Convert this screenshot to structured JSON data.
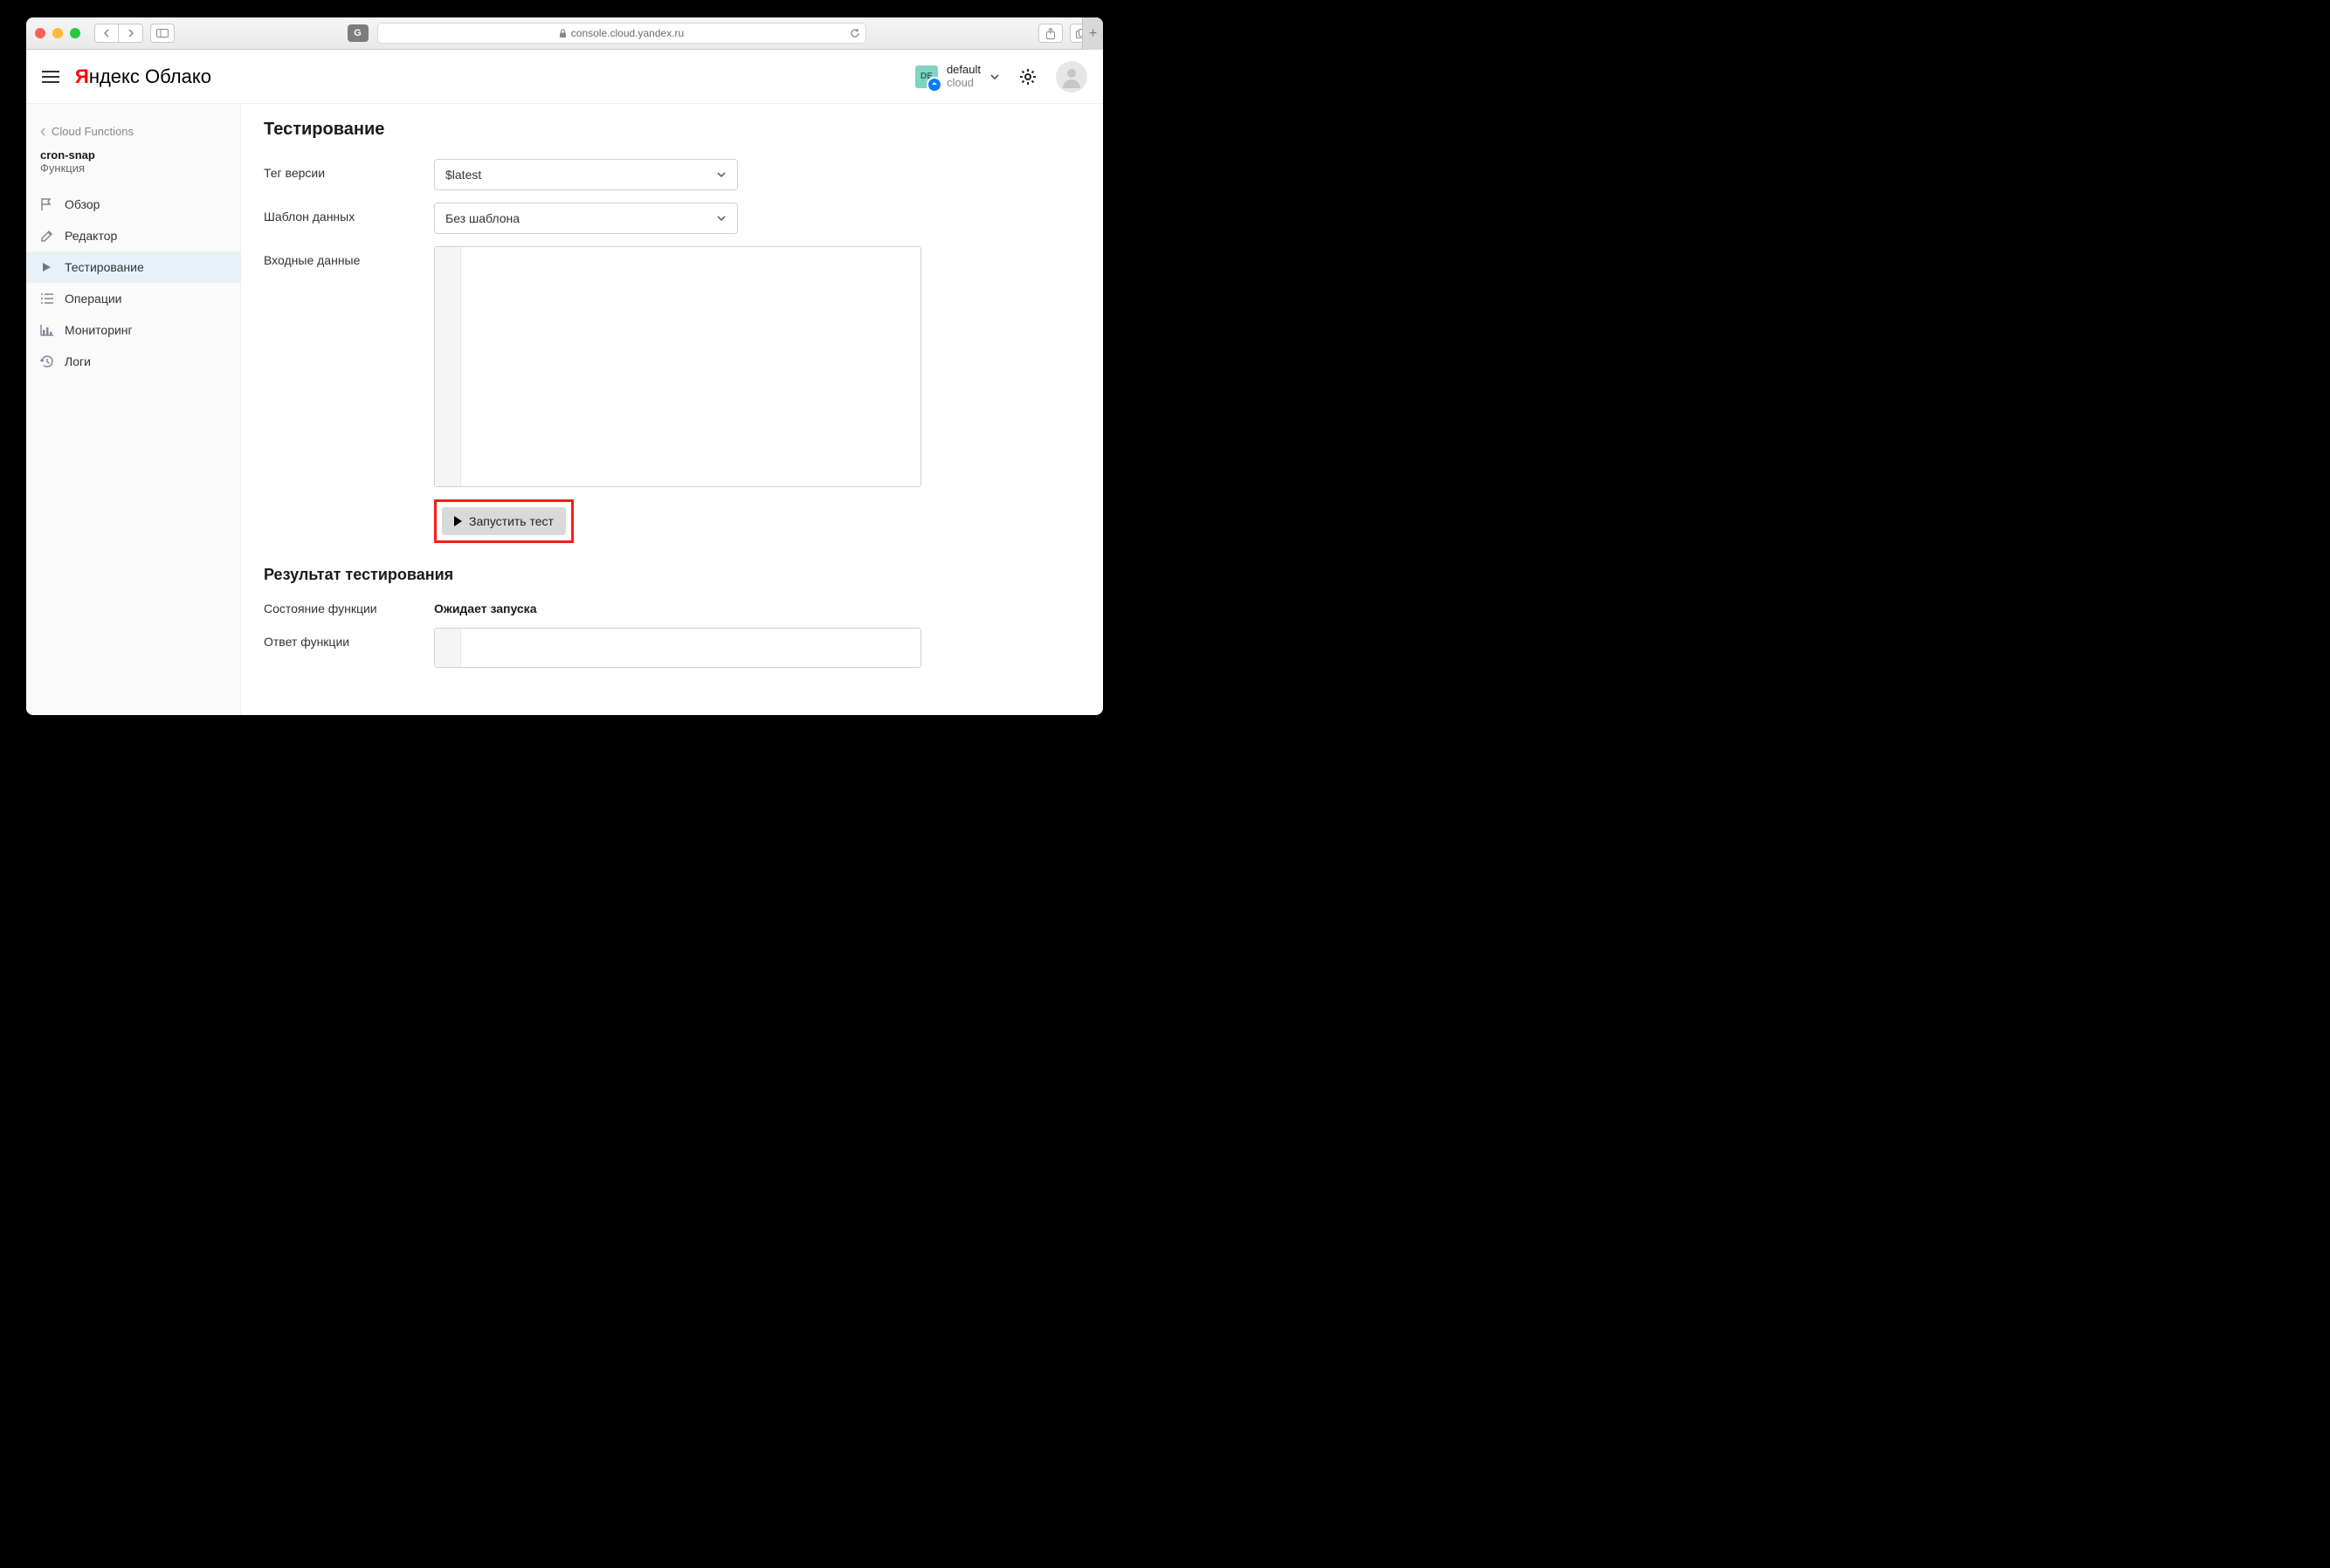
{
  "browser": {
    "url": "console.cloud.yandex.ru",
    "reader_badge": "G"
  },
  "header": {
    "logo_prefix": "Я",
    "logo_ndex": "ндекс",
    "logo_cloud": " Облако",
    "cloud_badge": "DE",
    "cloud_name": "default",
    "cloud_sub": "cloud"
  },
  "sidebar": {
    "breadcrumb": "Cloud Functions",
    "function_name": "cron-snap",
    "function_sub": "Функция",
    "items": [
      {
        "label": "Обзор"
      },
      {
        "label": "Редактор"
      },
      {
        "label": "Тестирование"
      },
      {
        "label": "Операции"
      },
      {
        "label": "Мониторинг"
      },
      {
        "label": "Логи"
      }
    ]
  },
  "main": {
    "title": "Тестирование",
    "version_tag_label": "Тег версии",
    "version_tag_value": "$latest",
    "template_label": "Шаблон данных",
    "template_value": "Без шаблона",
    "input_label": "Входные данные",
    "run_button": "Запустить тест",
    "result_title": "Результат тестирования",
    "state_label": "Состояние функции",
    "state_value": "Ожидает запуска",
    "response_label": "Ответ функции"
  }
}
